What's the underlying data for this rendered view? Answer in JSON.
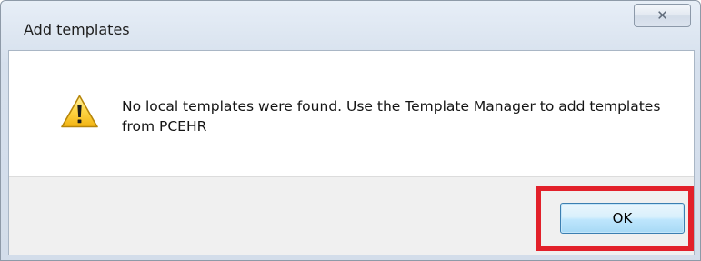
{
  "window": {
    "title": "Add templates",
    "close_icon": "close-icon",
    "close_glyph": "✕"
  },
  "message": {
    "icon": "warning-icon",
    "text": "No local templates were found. Use the Template Manager to add templates from PCEHR"
  },
  "buttons": {
    "ok_label": "OK"
  },
  "annotation": {
    "highlight_color": "#e2202a"
  }
}
